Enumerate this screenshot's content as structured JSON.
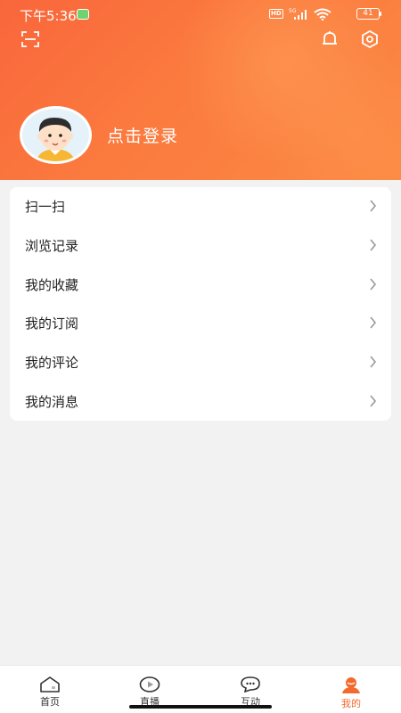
{
  "status_bar": {
    "time": "下午5:36",
    "hd_label": "HD",
    "network_label": "5G",
    "battery_level": "41"
  },
  "header": {
    "login_label": "点击登录"
  },
  "menu": {
    "items": [
      {
        "label": "扫一扫"
      },
      {
        "label": "浏览记录"
      },
      {
        "label": "我的收藏"
      },
      {
        "label": "我的订阅"
      },
      {
        "label": "我的评论"
      },
      {
        "label": "我的消息"
      }
    ]
  },
  "tabbar": {
    "tabs": [
      {
        "label": "首页",
        "icon": "home-icon"
      },
      {
        "label": "直播",
        "icon": "live-icon"
      },
      {
        "label": "互动",
        "icon": "chat-icon"
      },
      {
        "label": "我的",
        "icon": "profile-icon",
        "active": true
      }
    ]
  },
  "colors": {
    "accent": "#f26a2e",
    "header_start": "#f9663c",
    "header_end": "#fb8a44",
    "background": "#f2f2f2"
  }
}
